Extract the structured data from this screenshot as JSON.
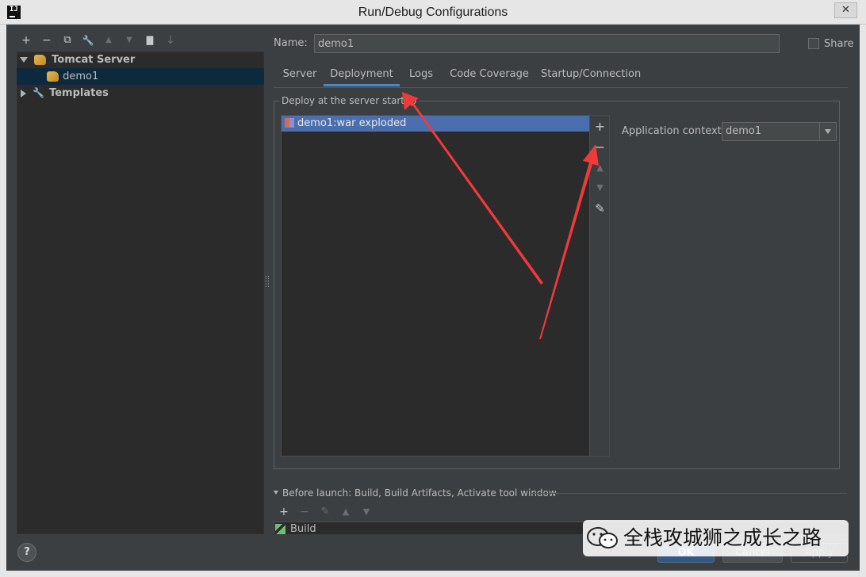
{
  "window": {
    "title": "Run/Debug Configurations",
    "logo": "IJ",
    "close_glyph": "✕"
  },
  "left_toolbar": [
    {
      "name": "add-icon",
      "glyph": "+"
    },
    {
      "name": "remove-icon",
      "glyph": "−"
    },
    {
      "name": "copy-icon",
      "glyph": "⧉"
    },
    {
      "name": "wrench-icon",
      "glyph": "🔧"
    },
    {
      "name": "move-up-icon",
      "glyph": "▲"
    },
    {
      "name": "move-down-icon",
      "glyph": "▼"
    },
    {
      "name": "folder-icon",
      "glyph": "▇"
    },
    {
      "name": "sort-icon",
      "glyph": "↓"
    }
  ],
  "tree": {
    "group_label": "Tomcat Server",
    "child_label": "demo1",
    "templates_label": "Templates"
  },
  "name_field": {
    "label": "Name:",
    "value": "demo1"
  },
  "share": {
    "label": "Share",
    "checked": false
  },
  "tabs": [
    {
      "label": "Server",
      "active": false
    },
    {
      "label": "Deployment",
      "active": true
    },
    {
      "label": "Logs",
      "active": false
    },
    {
      "label": "Code Coverage",
      "active": false
    },
    {
      "label": "Startup/Connection",
      "active": false
    }
  ],
  "deployment": {
    "group_title": "Deploy at the server startup",
    "artifact": "demo1:war exploded",
    "side_buttons": {
      "add": "+",
      "remove": "−",
      "up": "▲",
      "down": "▼",
      "edit": "✎"
    },
    "context_label": "Application context:",
    "context_value": "demo1"
  },
  "before_launch": {
    "title": "Before launch: Build, Build Artifacts, Activate tool window",
    "toolbar": {
      "add": "+",
      "remove": "−",
      "edit": "✎",
      "up": "▲",
      "down": "▼"
    },
    "item": "Build"
  },
  "buttons": {
    "help": "?",
    "ok": "OK",
    "cancel": "Cancel",
    "apply": "Apply"
  },
  "watermark": {
    "text": "全栈攻城狮之成长之路"
  },
  "colors": {
    "accent": "#4a88c7",
    "selection": "#4b6eaf",
    "arrow": "#f03a3a"
  }
}
